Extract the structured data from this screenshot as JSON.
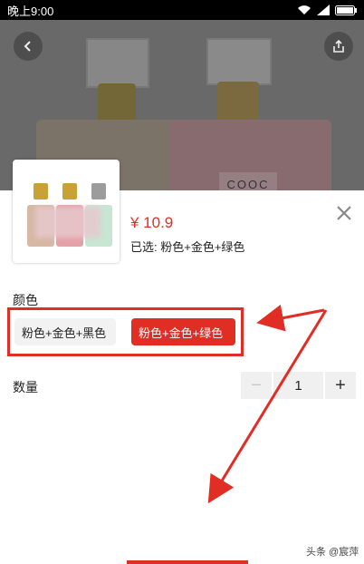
{
  "status_bar": {
    "time": "晚上9:00"
  },
  "hero": {
    "brand_text": "COOC"
  },
  "product": {
    "price": "¥ 10.9",
    "selected": "已选: 粉色+金色+绿色"
  },
  "color_section": {
    "title": "颜色",
    "options": [
      {
        "label": "粉色+金色+黑色",
        "selected": false
      },
      {
        "label": "粉色+金色+绿色",
        "selected": true
      }
    ]
  },
  "quantity_section": {
    "title": "数量",
    "minus": "−",
    "value": "1",
    "plus": "+"
  },
  "watermark": "头条 @宸萍",
  "colors": {
    "accent": "#e02e24"
  }
}
